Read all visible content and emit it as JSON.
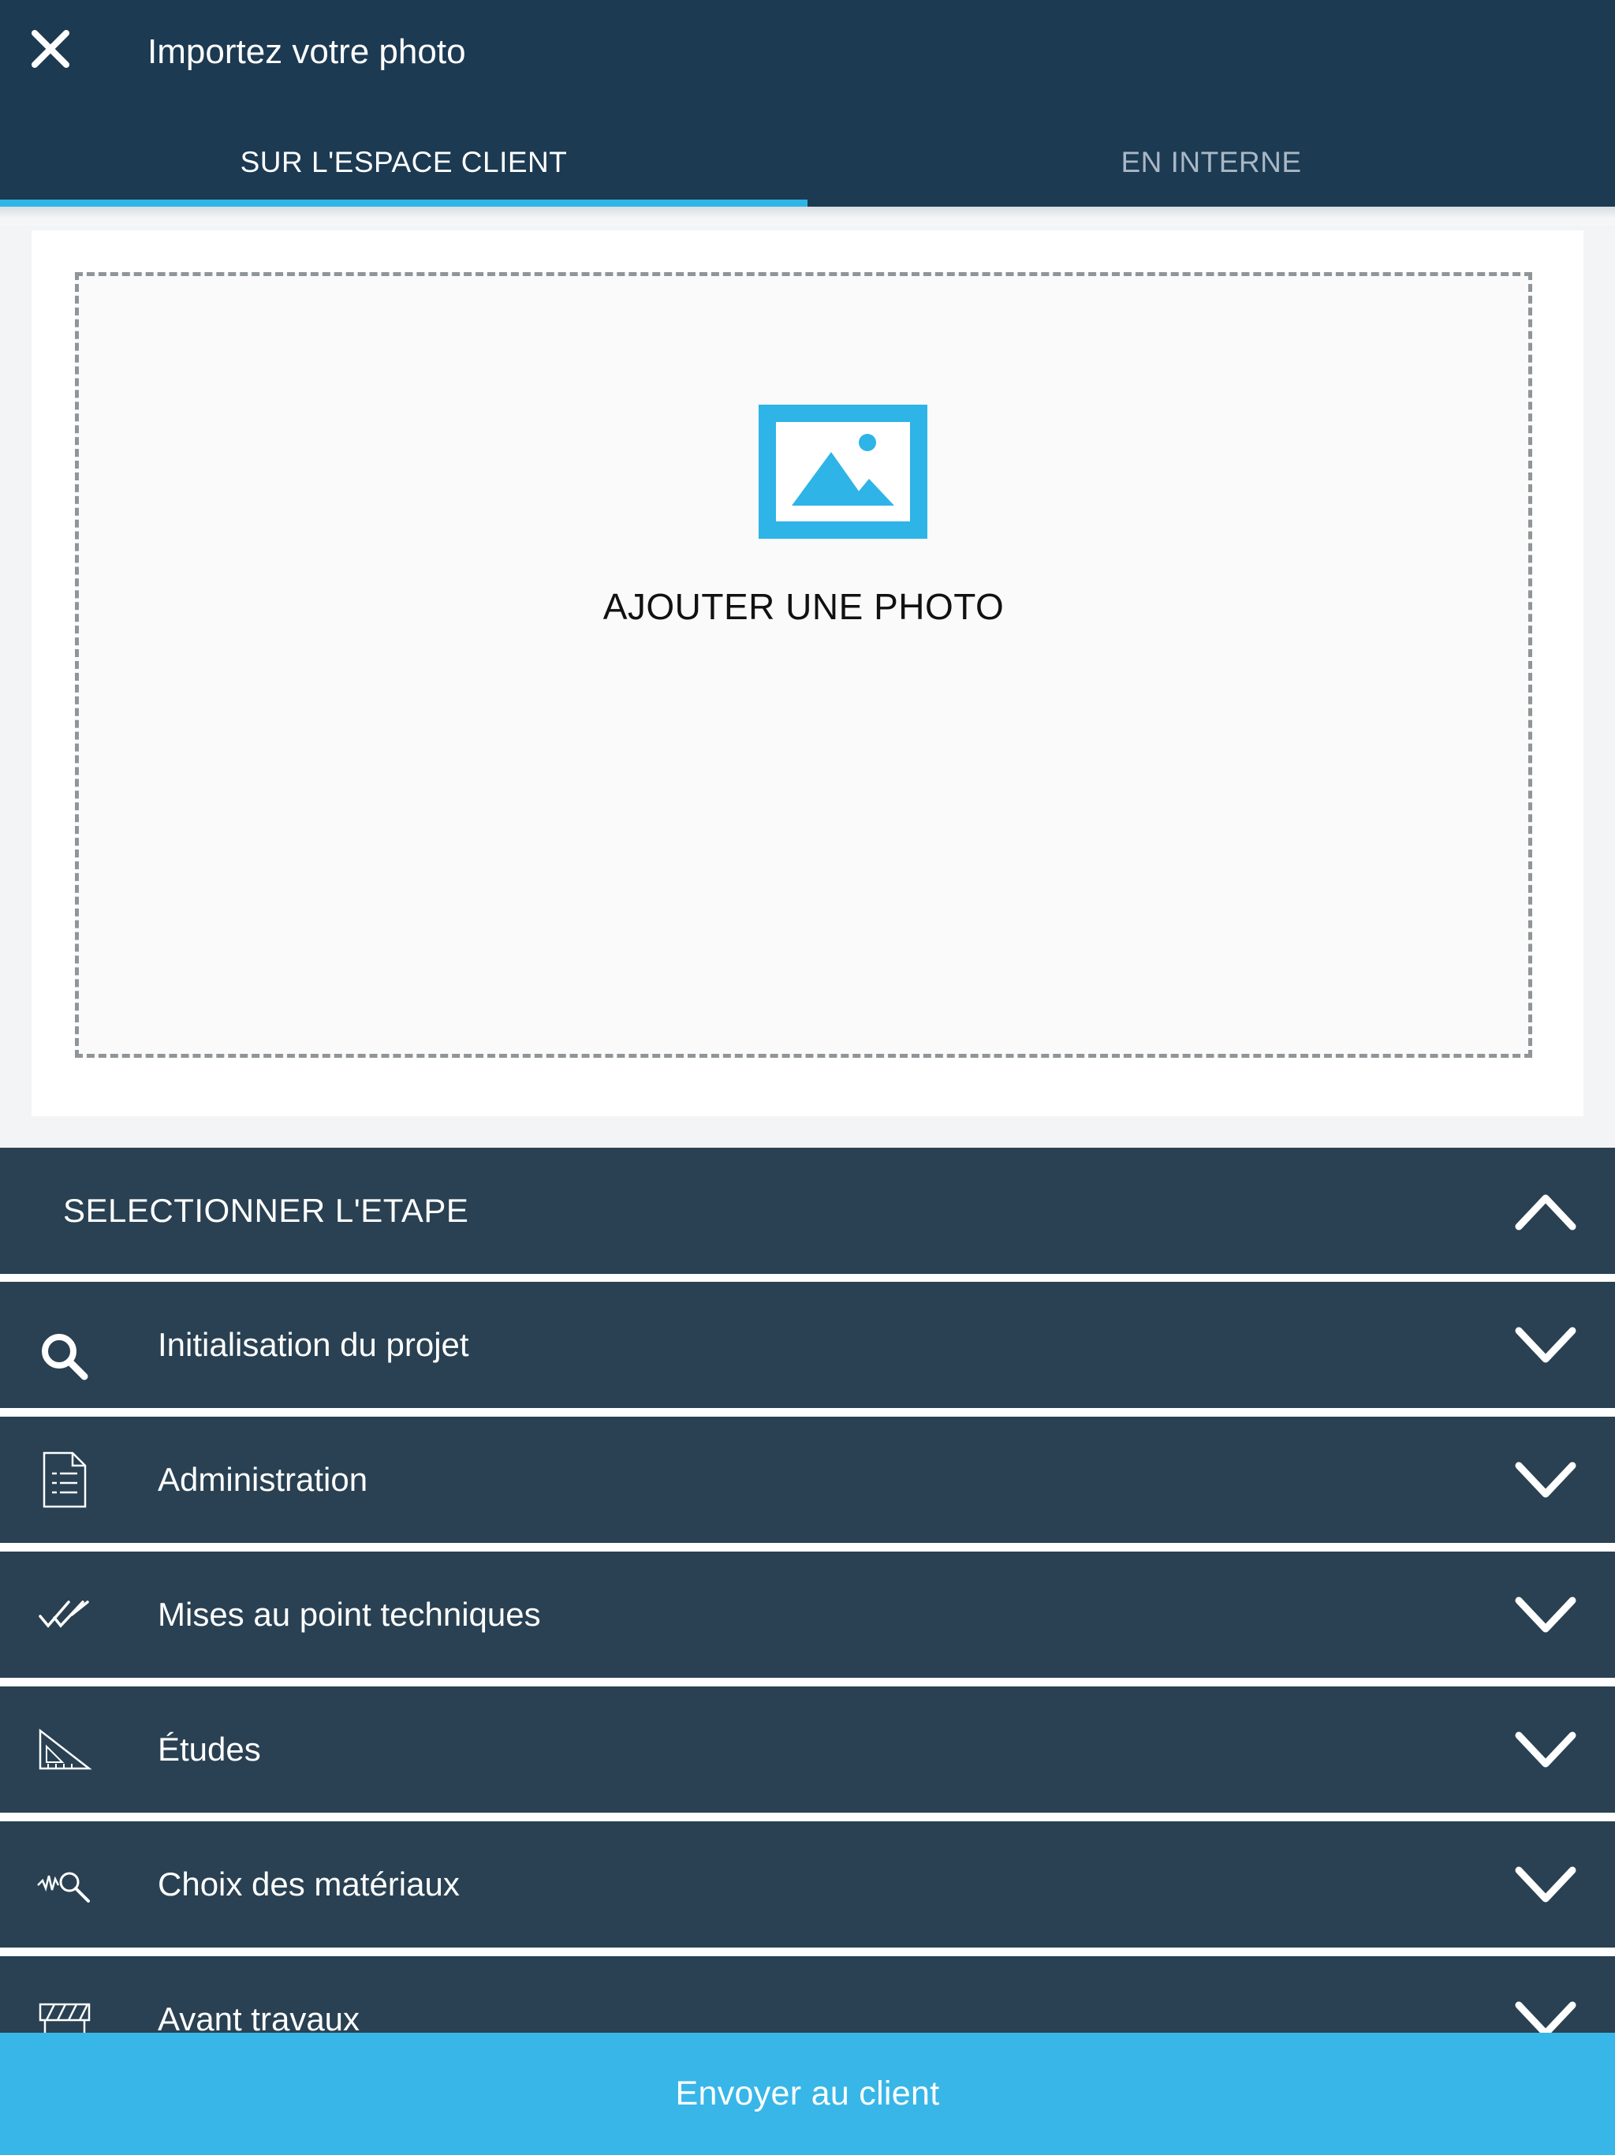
{
  "header": {
    "title": "Importez votre photo",
    "close_icon": "close-icon",
    "tabs": [
      {
        "label": "SUR L'ESPACE CLIENT",
        "active": true
      },
      {
        "label": "EN INTERNE",
        "active": false
      }
    ]
  },
  "upload": {
    "icon": "image-icon",
    "label": "AJOUTER UNE PHOTO"
  },
  "steps": {
    "header_label": "SELECTIONNER L'ETAPE",
    "header_icon": "chevron-up-icon",
    "items": [
      {
        "label": "Initialisation du projet",
        "icon": "search-icon"
      },
      {
        "label": "Administration",
        "icon": "document-checklist-icon"
      },
      {
        "label": "Mises au point techniques",
        "icon": "double-check-icon"
      },
      {
        "label": "Études",
        "icon": "set-square-icon"
      },
      {
        "label": "Choix des matériaux",
        "icon": "material-search-icon"
      },
      {
        "label": "Avant travaux",
        "icon": "barrier-icon"
      }
    ]
  },
  "footer": {
    "send_label": "Envoyer au client"
  },
  "colors": {
    "header_bg": "#1c3a52",
    "row_bg": "#294152",
    "accent": "#2eb4e6",
    "button_bg": "#38b6e8"
  }
}
